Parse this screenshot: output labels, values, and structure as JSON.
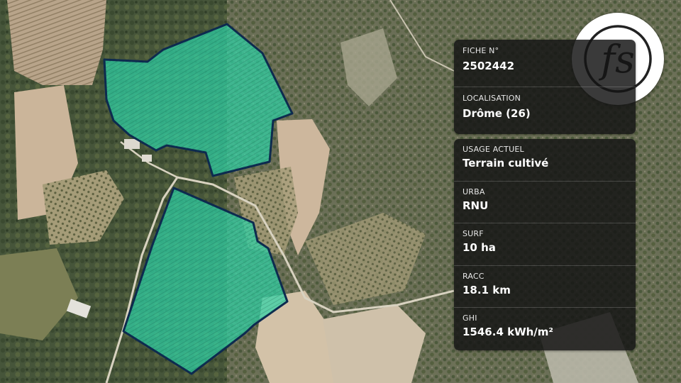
{
  "map": {
    "colors": {
      "parcel_fill": "#2fd3a6",
      "parcel_stroke": "#0d2a4f",
      "forest": "#4a5a38",
      "field": "#c7b49a",
      "orchard": "#9a9270"
    }
  },
  "logo": {
    "text": "fs",
    "icon": "fs-monogram-logo"
  },
  "fiche": {
    "number_label": "FICHE N°",
    "number_value": "2502442",
    "location_label": "LOCALISATION",
    "location_value": "Drôme (26)"
  },
  "details": [
    {
      "label": "USAGE ACTUEL",
      "value": "Terrain cultivé"
    },
    {
      "label": "URBA",
      "value": "RNU"
    },
    {
      "label": "SURF",
      "value": "10 ha"
    },
    {
      "label": "RACC",
      "value": "18.1 km"
    },
    {
      "label": "GHI",
      "value": "1546.4 kWh/m²"
    }
  ]
}
